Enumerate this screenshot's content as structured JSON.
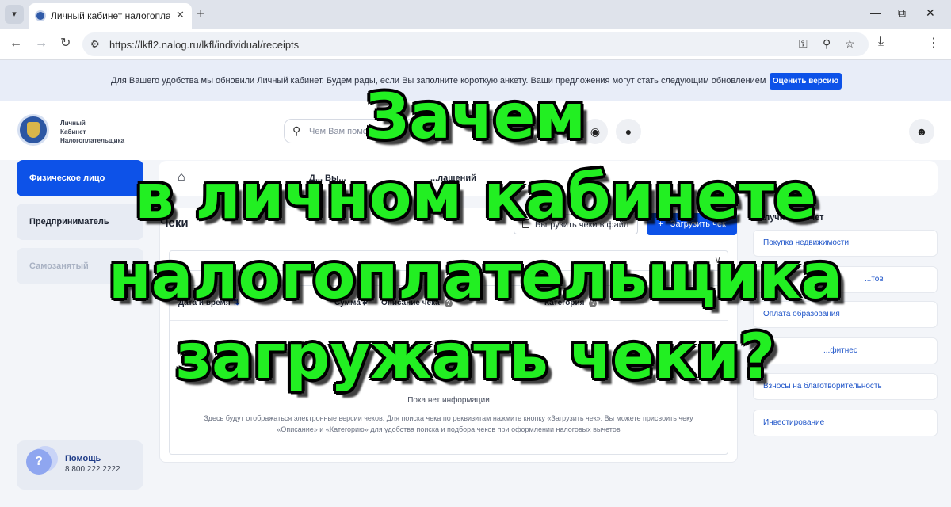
{
  "browser": {
    "tab_title": "Личный кабинет налогоплательщика",
    "url": "https://lkfl2.nalog.ru/lkfl/individual/receipts",
    "icons": [
      "tab-list-icon",
      "close-icon",
      "plus-icon",
      "minimize-icon",
      "restore-icon",
      "close-window-icon",
      "back-arrow-icon",
      "forward-arrow-icon",
      "reload-icon",
      "site-info-icon",
      "key-icon",
      "zoom-icon",
      "star-icon",
      "download-icon",
      "kebab-menu-icon"
    ]
  },
  "banner": {
    "text": "Для Вашего удобства мы обновили Личный кабинет. Будем рады, если Вы заполните короткую анкету. Ваши предложения могут стать следующим обновлением",
    "button": "Оценить версию"
  },
  "header": {
    "logo_line1": "Личный",
    "logo_line2": "Кабинет",
    "logo_line3": "Налогоплательщика",
    "search_placeholder": "Чем Вам помочь?"
  },
  "sidebar": {
    "items": [
      {
        "label": "Физическое лицо"
      },
      {
        "label": "Предприниматель"
      },
      {
        "label": "Самозанятый"
      }
    ],
    "help_title": "Помощь",
    "help_phone": "8 800 222 2222"
  },
  "breadcrumb": {
    "item1": "Д... Вы...",
    "item2": "...лащений"
  },
  "main": {
    "title": "Чеки",
    "export_button": "Выгрузить чеки в файл",
    "upload_button": "Загрузить чек",
    "columns": [
      "Дата и время",
      "Сумма ₽",
      "Описание чека",
      "Категория"
    ],
    "empty_title": "Пока нет информации",
    "empty_desc": "Здесь будут отображаться электронные версии чеков. Для поиска чека по реквизитам нажмите кнопку «Загрузить чек». Вы можете присвоить чеку «Описание» и «Категорию» для удобства поиска и подбора чеков при оформлении налоговых вычетов"
  },
  "deductions": {
    "title": "Получить вычет",
    "items": [
      "Покупка недвижимости",
      "...тов",
      "Оплата образования",
      "...фитнес",
      "Взносы на благотворительность",
      "Инвестирование"
    ]
  },
  "headline": {
    "line1": "Зачем",
    "line2": "в личном кабинете",
    "line3": "налогоплательщика",
    "line4": "загружать чеки?"
  },
  "colors": {
    "accent": "#0d52e8",
    "headline": "#22ef22",
    "headline_outline": "#000000"
  }
}
